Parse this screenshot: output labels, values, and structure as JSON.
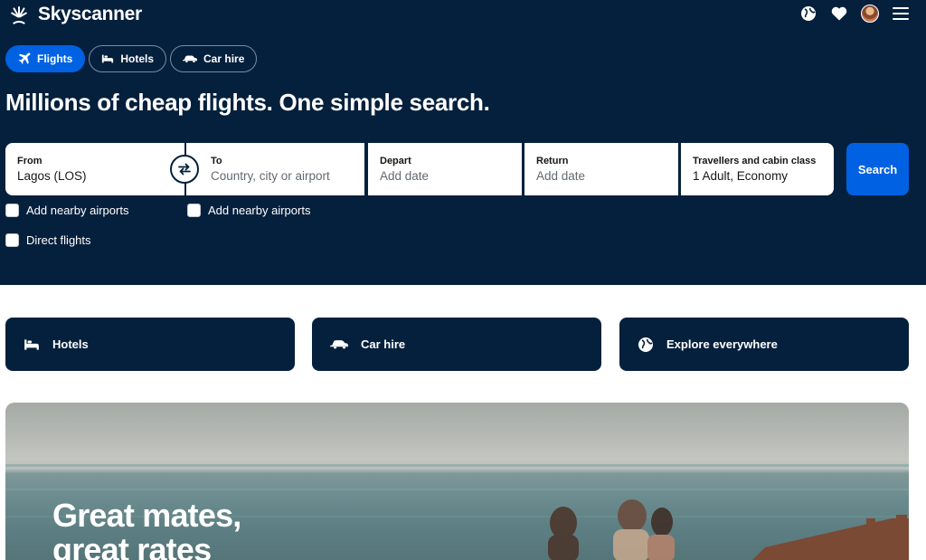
{
  "header": {
    "brand": "Skyscanner",
    "icons": [
      "globe-icon",
      "heart-icon",
      "avatar",
      "menu-icon"
    ]
  },
  "tabs": [
    {
      "label": "Flights",
      "icon": "plane-icon",
      "active": true
    },
    {
      "label": "Hotels",
      "icon": "bed-icon",
      "active": false
    },
    {
      "label": "Car hire",
      "icon": "car-icon",
      "active": false
    }
  ],
  "headline": "Millions of cheap flights. One simple search.",
  "search": {
    "from": {
      "label": "From",
      "value": "Lagos (LOS)"
    },
    "to": {
      "label": "To",
      "placeholder": "Country, city or airport"
    },
    "depart": {
      "label": "Depart",
      "placeholder": "Add date"
    },
    "return": {
      "label": "Return",
      "placeholder": "Add date"
    },
    "travellers": {
      "label": "Travellers and cabin class",
      "value": "1 Adult, Economy"
    },
    "button": "Search"
  },
  "options": {
    "nearby_from": "Add nearby airports",
    "nearby_to": "Add nearby airports",
    "direct": "Direct flights"
  },
  "quick_links": [
    {
      "label": "Hotels",
      "icon": "bed-icon"
    },
    {
      "label": "Car hire",
      "icon": "car-icon"
    },
    {
      "label": "Explore everywhere",
      "icon": "globe-icon"
    }
  ],
  "banner": {
    "line1": "Great mates,",
    "line2": "great rates"
  },
  "colors": {
    "navy": "#05203c",
    "accent": "#0062e3"
  }
}
